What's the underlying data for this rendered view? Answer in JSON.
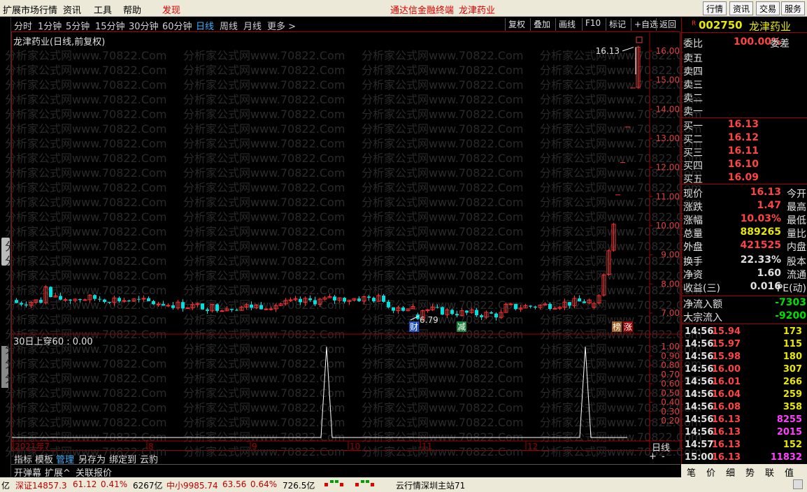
{
  "menu": {
    "left": [
      "扩展市场行情",
      "资讯",
      "工具",
      "帮助"
    ],
    "discover": "发现",
    "title_app": "通达信金融终端",
    "title_stock": "龙津药业",
    "right_buttons": [
      "行情",
      "资讯",
      "交易",
      "服务"
    ]
  },
  "periods": [
    "分时",
    "1分钟",
    "5分钟",
    "15分钟",
    "30分钟",
    "60分钟",
    "日线",
    "周线",
    "月线",
    "更多 >"
  ],
  "active_period": "日线",
  "toolbar": [
    "复权",
    "叠加",
    "画线",
    "F10",
    "标记",
    "+自选",
    "返回"
  ],
  "chart": {
    "title": "龙津药业(日线,前复权)",
    "indicator_title": "30日上穿60 : 0.00",
    "watermark": "分析家公式网www.70822.Com",
    "price_ticks": [
      "16.00",
      "15.00",
      "14.00",
      "13.00",
      "12.00",
      "11.00",
      "10.00",
      "9.00",
      "8.00",
      "7.00"
    ],
    "ind_ticks": [
      "1.00",
      "0.90",
      "0.80",
      "0.70",
      "0.60",
      "0.50",
      "0.40",
      "0.30",
      "0.20"
    ],
    "dates": [
      "2021年7",
      "8",
      "9",
      "10",
      "11",
      "12"
    ],
    "high_label": "16.13",
    "low_label": "6.79",
    "markers": [
      "财",
      "减",
      "榜",
      "涨"
    ],
    "period_label": "日线",
    "zoom": [
      "+",
      "-"
    ],
    "colors": {
      "up": "#ff3030",
      "down": "#00e0e0",
      "axis": "#a00000"
    }
  },
  "chart_data": {
    "type": "candlestick",
    "title": "龙津药业(日线,前复权)",
    "ylim": [
      6.5,
      16.5
    ],
    "closes_summary": "flat ~7.2-7.6 from 2021-07 through 2021-12 then rally to 16.13",
    "last_days": [
      7.33,
      7.6,
      8.31,
      9.14,
      10.05,
      11.06,
      12.17,
      13.39,
      14.73,
      16.13
    ],
    "indicator": {
      "name": "30日上穿60",
      "spikes_at": [
        "10月初",
        "12月下旬"
      ],
      "value": 0.0
    }
  },
  "quote": {
    "code": "002750",
    "name": "龙津药业",
    "wb_label": "委比",
    "wb_val": "100.00%",
    "wc_label": "委差",
    "sells": [
      "卖五",
      "卖四",
      "卖三",
      "卖二",
      "卖一"
    ],
    "buys": [
      {
        "label": "买一",
        "price": "16.13"
      },
      {
        "label": "买二",
        "price": "16.12"
      },
      {
        "label": "买三",
        "price": "16.11"
      },
      {
        "label": "买四",
        "price": "16.10"
      },
      {
        "label": "买五",
        "price": "16.09"
      }
    ],
    "stats": [
      {
        "l": "现价",
        "v": "16.13",
        "r": "今开",
        "c": "#ff4444"
      },
      {
        "l": "涨跌",
        "v": "1.47",
        "r": "最高",
        "c": "#ff4444"
      },
      {
        "l": "涨幅",
        "v": "10.03%",
        "r": "最低",
        "c": "#ff4444"
      },
      {
        "l": "总量",
        "v": "889265",
        "r": "量比",
        "c": "#e8e800"
      },
      {
        "l": "外盘",
        "v": "421525",
        "r": "内盘",
        "c": "#ff4444"
      },
      {
        "l": "换手",
        "v": "22.33%",
        "r": "股本",
        "c": "#e0e0e0"
      },
      {
        "l": "净资",
        "v": "1.60",
        "r": "流通",
        "c": "#e0e0e0"
      },
      {
        "l": "收益(三)",
        "v": "0.016",
        "r": "PE(动)",
        "c": "#e0e0e0"
      }
    ],
    "flow": [
      {
        "l": "净流入额",
        "v": "-7303"
      },
      {
        "l": "大宗流入",
        "v": "-9200"
      }
    ],
    "ticks": [
      {
        "t": "14:56",
        "p": "15.94",
        "v": "173",
        "vc": "#e8e800"
      },
      {
        "t": "14:56",
        "p": "15.97",
        "v": "115",
        "vc": "#e8e800"
      },
      {
        "t": "14:56",
        "p": "15.98",
        "v": "180",
        "vc": "#e8e800"
      },
      {
        "t": "14:56",
        "p": "16.00",
        "v": "307",
        "vc": "#e8e800"
      },
      {
        "t": "14:56",
        "p": "16.01",
        "v": "266",
        "vc": "#e8e800"
      },
      {
        "t": "14:56",
        "p": "16.04",
        "v": "259",
        "vc": "#e8e800"
      },
      {
        "t": "14:56",
        "p": "16.08",
        "v": "358",
        "vc": "#e8e800"
      },
      {
        "t": "14:56",
        "p": "16.13",
        "v": "8255",
        "vc": "#ff40ff"
      },
      {
        "t": "14:56",
        "p": "16.13",
        "v": "2015",
        "vc": "#ff40ff"
      },
      {
        "t": "14:57",
        "p": "16.13",
        "v": "152",
        "vc": "#e8e800"
      },
      {
        "t": "15:00",
        "p": "16.13",
        "v": "11832",
        "vc": "#ff40ff"
      }
    ],
    "tabs": [
      "笔",
      "价",
      "细",
      "势",
      "联",
      "值"
    ]
  },
  "bottom_tabs": [
    "指标",
    "模板",
    "管理",
    "另存为",
    "绑定到",
    "云豹"
  ],
  "bottom_tabs2": [
    "开弹幕",
    "扩展^",
    "关联报价"
  ],
  "status": {
    "s1": "亿",
    "s2": "深证14857.3",
    "s3": "61.12",
    "s4": "0.41%",
    "s5": "6267亿",
    "s6": "中小9985.74",
    "s7": "63.56",
    "s8": "0.64%",
    "s9": "726.5亿",
    "s10": "云行情深圳主站71"
  }
}
